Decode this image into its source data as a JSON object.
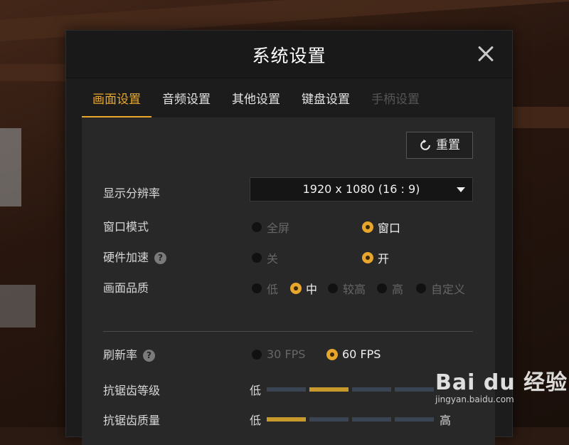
{
  "dialog": {
    "title": "系统设置",
    "close_icon": "close-icon"
  },
  "tabs": [
    {
      "label": "画面设置",
      "state": "active"
    },
    {
      "label": "音频设置",
      "state": "normal"
    },
    {
      "label": "其他设置",
      "state": "normal"
    },
    {
      "label": "键盘设置",
      "state": "normal"
    },
    {
      "label": "手柄设置",
      "state": "disabled"
    }
  ],
  "reset": {
    "label": "重置",
    "icon": "refresh-icon"
  },
  "settings": {
    "resolution": {
      "label": "显示分辨率",
      "value": "1920 x 1080 (16 : 9)"
    },
    "window_mode": {
      "label": "窗口模式",
      "options": [
        "全屏",
        "窗口"
      ],
      "selected": "窗口"
    },
    "hardware_accel": {
      "label": "硬件加速",
      "options": [
        "关",
        "开"
      ],
      "selected": "开"
    },
    "quality": {
      "label": "画面品质",
      "options": [
        "低",
        "中",
        "较高",
        "高",
        "自定义"
      ],
      "selected": "中"
    },
    "refresh": {
      "label": "刷新率",
      "options": [
        "30 FPS",
        "60 FPS"
      ],
      "selected": "60 FPS"
    },
    "aa_level": {
      "label": "抗锯齿等级",
      "low_label": "低",
      "segments": 4,
      "selected_index": 1
    },
    "aa_quality": {
      "label": "抗锯齿质量",
      "low_label": "低",
      "high_label": "高",
      "segments": 4,
      "selected_index": 0
    }
  },
  "help_icon": "?",
  "watermark": {
    "main": "Bai du 经验",
    "sub": "jingyan.baidu.com"
  },
  "colors": {
    "accent": "#e8a72c",
    "panel": "#282828",
    "dialog": "#1c1c1c"
  }
}
